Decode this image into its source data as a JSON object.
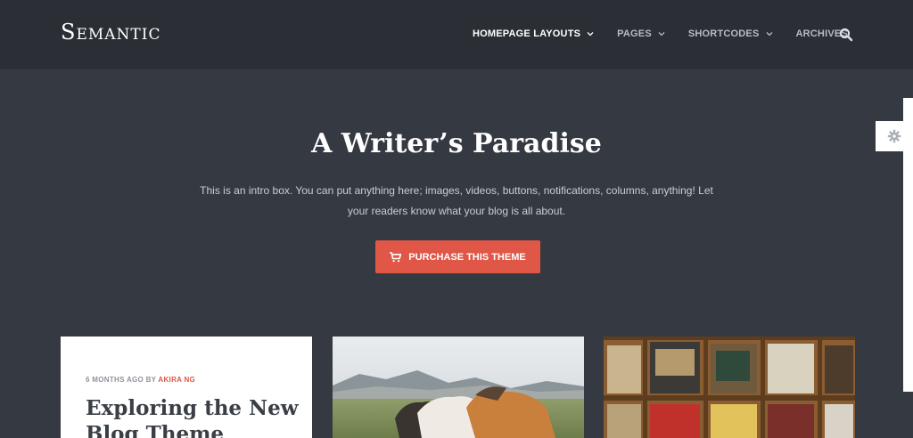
{
  "header": {
    "logo": "Semantic",
    "nav": [
      {
        "label": "HOMEPAGE LAYOUTS",
        "has_dropdown": true,
        "active": true
      },
      {
        "label": "PAGES",
        "has_dropdown": true,
        "active": false
      },
      {
        "label": "SHORTCODES",
        "has_dropdown": true,
        "active": false
      },
      {
        "label": "ARCHIVES",
        "has_dropdown": false,
        "active": false
      }
    ],
    "search_icon": "search-icon"
  },
  "hero": {
    "title": "A Writer’s Paradise",
    "text": "This is an intro box. You can put anything here; images, videos, buttons, notifications, columns, anything! Let your readers know what your blog is all about.",
    "cta_label": "PURCHASE THIS THEME",
    "cta_icon": "shopping-cart-icon"
  },
  "side_panel": {
    "icon": "gear-icon"
  },
  "cards": [
    {
      "meta_prefix": "6 MONTHS AGO BY ",
      "author": "AKIRA NG",
      "title": "Exploring the New Blog Theme"
    },
    {
      "image": "horses-landscape-photo"
    },
    {
      "image": "record-shelf-photo"
    }
  ],
  "colors": {
    "header_bg": "#2b2f35",
    "page_bg": "#353a42",
    "accent": "#e05647"
  }
}
